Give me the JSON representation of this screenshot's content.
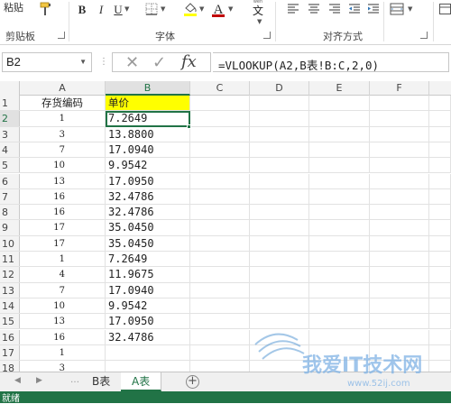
{
  "ribbon": {
    "paste_label": "粘贴",
    "clipboard_group": "剪贴板",
    "font_group": "字体",
    "align_group": "对齐方式",
    "bold": "B",
    "italic": "I",
    "underline": "U",
    "font_color_letter": "A",
    "phonetic_char": "文",
    "font_color": "#c00000",
    "fill_color": "#ffff00"
  },
  "formula_bar": {
    "name_box": "B2",
    "formula": "=VLOOKUP(A2,B表!B:C,2,0)"
  },
  "grid": {
    "columns": [
      "A",
      "B",
      "C",
      "D",
      "E",
      "F"
    ],
    "active_column": "B",
    "active_row": "2",
    "row_numbers": [
      "1",
      "2",
      "3",
      "4",
      "5",
      "6",
      "7",
      "8",
      "9",
      "10",
      "11",
      "12",
      "13",
      "14",
      "15",
      "16",
      "17",
      "18"
    ],
    "header_a": "存货编码",
    "header_b": "单价",
    "codes": [
      "1",
      "3",
      "7",
      "10",
      "13",
      "16",
      "16",
      "17",
      "17",
      "1",
      "4",
      "7",
      "10",
      "13",
      "16",
      "1",
      "3"
    ],
    "prices": [
      "7.2649",
      "13.8800",
      "17.0940",
      "9.9542",
      "17.0950",
      "32.4786",
      "32.4786",
      "35.0450",
      "35.0450",
      "7.2649",
      "11.9675",
      "17.0940",
      "9.9542",
      "17.0950",
      "32.4786",
      "",
      ""
    ]
  },
  "tabs": {
    "sheets": [
      "B表",
      "A表"
    ],
    "active": "A表",
    "add_label": "+"
  },
  "status": {
    "text": "就绪"
  },
  "watermark": {
    "text": "我爱IT技术网",
    "url": "www.52ij.com"
  }
}
